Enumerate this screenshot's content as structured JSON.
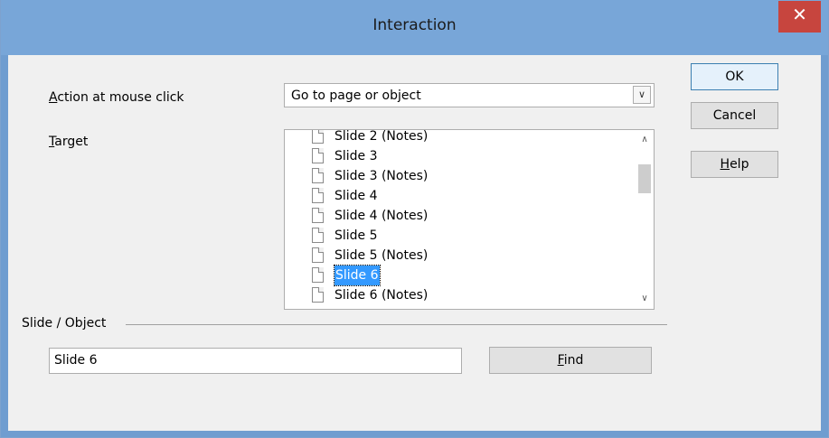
{
  "window": {
    "title": "Interaction",
    "close_label": "✕"
  },
  "action": {
    "label_mnemonic": "A",
    "label_rest": "ction at mouse click",
    "selected": "Go to page or object",
    "dropdown_icon": "chevron-down-icon"
  },
  "target": {
    "label_mnemonic": "T",
    "label_rest": "arget",
    "items": [
      {
        "label": "Slide 2 (Notes)",
        "selected": false
      },
      {
        "label": "Slide 3",
        "selected": false
      },
      {
        "label": "Slide 3 (Notes)",
        "selected": false
      },
      {
        "label": "Slide 4",
        "selected": false
      },
      {
        "label": "Slide 4 (Notes)",
        "selected": false
      },
      {
        "label": "Slide 5",
        "selected": false
      },
      {
        "label": "Slide 5 (Notes)",
        "selected": false
      },
      {
        "label": "Slide 6",
        "selected": true
      },
      {
        "label": "Slide 6 (Notes)",
        "selected": false
      }
    ]
  },
  "slide_object": {
    "group_label": "Slide / Object",
    "value": "Slide 6",
    "find_mnemonic": "F",
    "find_rest": "ind"
  },
  "buttons": {
    "ok": "OK",
    "cancel": "Cancel",
    "help_mnemonic": "H",
    "help_rest": "elp"
  },
  "colors": {
    "titlebar": "#78a6d8",
    "close": "#c7453e",
    "selection": "#3399ff"
  }
}
